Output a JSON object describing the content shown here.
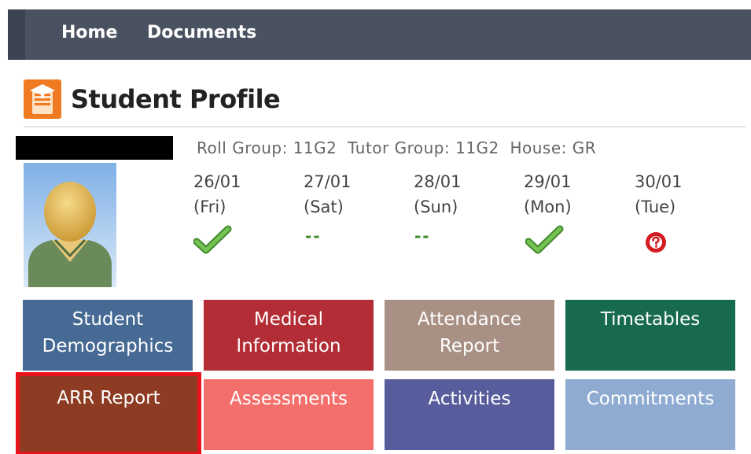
{
  "nav": {
    "home": "Home",
    "documents": "Documents"
  },
  "page": {
    "title": "Student Profile"
  },
  "student": {
    "roll_group": "Roll Group: 11G2",
    "tutor_group": "Tutor Group: 11G2",
    "house": "House: GR"
  },
  "attendance": [
    {
      "date": "26/01",
      "day": "(Fri)",
      "status": "present",
      "mark": ""
    },
    {
      "date": "27/01",
      "day": "(Sat)",
      "status": "none",
      "mark": "--"
    },
    {
      "date": "28/01",
      "day": "(Sun)",
      "status": "none",
      "mark": "--"
    },
    {
      "date": "29/01",
      "day": "(Mon)",
      "status": "present",
      "mark": ""
    },
    {
      "date": "30/01",
      "day": "(Tue)",
      "status": "unknown",
      "mark": ""
    }
  ],
  "tiles": [
    {
      "label_line1": "Student",
      "label_line2": "Demographics",
      "color": "#466a94"
    },
    {
      "label_line1": "Medical",
      "label_line2": "Information",
      "color": "#b22d35"
    },
    {
      "label_line1": "Attendance",
      "label_line2": "Report",
      "color": "#a89184"
    },
    {
      "label_line1": "Timetables",
      "label_line2": "",
      "color": "#176a4f"
    },
    {
      "label_line1": "ARR Report",
      "label_line2": "",
      "color": "#8d3b22",
      "selected": true
    },
    {
      "label_line1": "Assessments",
      "label_line2": "",
      "color": "#f36f6b"
    },
    {
      "label_line1": "Activities",
      "label_line2": "",
      "color": "#575d9c"
    },
    {
      "label_line1": "Commitments",
      "label_line2": "",
      "color": "#8fabd2"
    }
  ],
  "colors": {
    "nav_bg": "#4a5160",
    "selected_outline": "#e8141c",
    "check_green": "#5aa33a",
    "unknown_red": "#d41b20"
  }
}
